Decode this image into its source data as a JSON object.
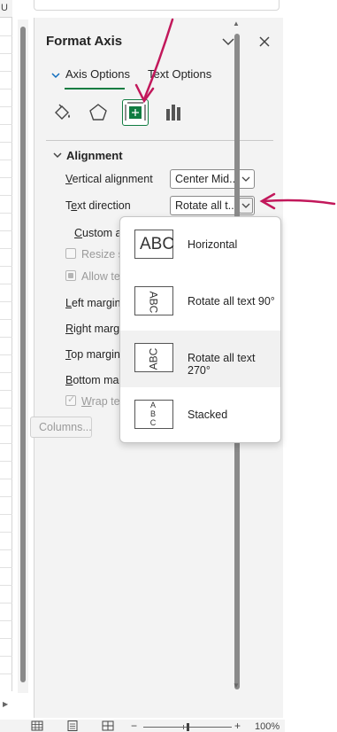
{
  "sheet": {
    "column_header": "U"
  },
  "panel": {
    "title": "Format Axis",
    "tabs": [
      {
        "label": "Axis Options",
        "active": true
      },
      {
        "label": "Text Options",
        "active": false
      }
    ],
    "icons": [
      "fill-line-icon",
      "effects-pentagon-icon",
      "size-properties-icon",
      "axis-options-bars-icon"
    ],
    "section": {
      "title": "Alignment",
      "vertical_alignment": {
        "label": "Vertical alignment",
        "value": "Center Mid..."
      },
      "text_direction": {
        "label": "Text direction",
        "value": "Rotate all t..."
      },
      "custom_angle": {
        "label": "Custom a"
      },
      "resize_shape": {
        "label": "Resize sh"
      },
      "allow_text": {
        "label": "Allow te"
      },
      "left_margin": {
        "label": "Left margin"
      },
      "right_margin": {
        "label": "Right margi"
      },
      "top_margin": {
        "label": "Top margin"
      },
      "bottom_margin": {
        "label": "Bottom mar"
      },
      "wrap_text": {
        "label": "Wrap tex"
      },
      "columns_button": "Columns..."
    }
  },
  "dropdown": {
    "items": [
      {
        "label": "Horizontal",
        "thumb": "ABC"
      },
      {
        "label": "Rotate all text 90°",
        "thumb": "ABC"
      },
      {
        "label": "Rotate all text 270°",
        "thumb": "ABC",
        "hovered": true
      },
      {
        "label": "Stacked",
        "thumb": "A B C"
      }
    ]
  },
  "status": {
    "zoom": "100%"
  },
  "colors": {
    "accent": "#107c41",
    "annotation": "#c2185b",
    "panel_bg": "#f3f3f3"
  }
}
